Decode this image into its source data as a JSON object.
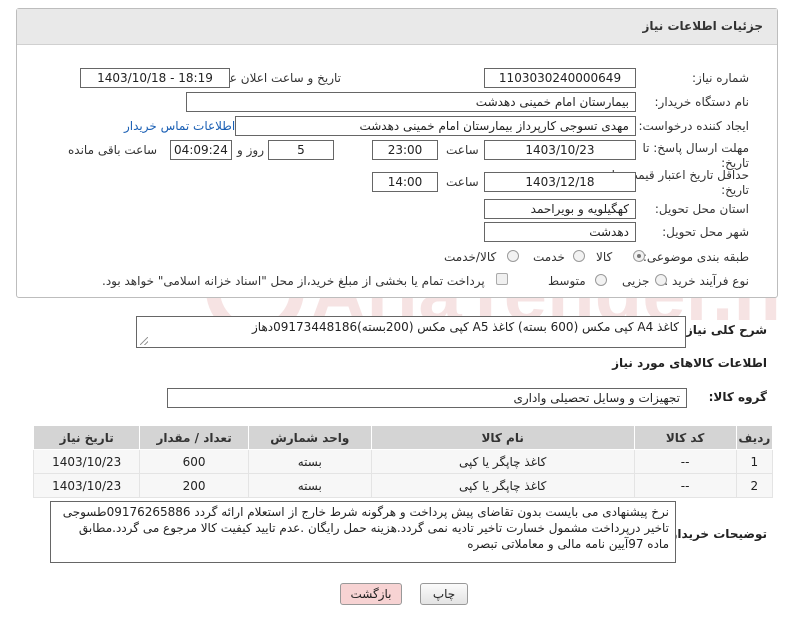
{
  "header": {
    "title": "جزئیات اطلاعات نیاز"
  },
  "fields": {
    "need_number": {
      "label": "شماره نیاز:",
      "value": "1103030240000649"
    },
    "announce_datetime": {
      "label": "تاریخ و ساعت اعلان عمومی:",
      "value": "1403/10/18 - 18:19"
    },
    "buyer_org": {
      "label": "نام دستگاه خریدار:",
      "value": "بیمارستان امام خمینی دهدشت"
    },
    "requester": {
      "label": "ایجاد کننده درخواست:",
      "value": "مهدی تسوجی کارپرداز بیمارستان امام خمینی دهدشت",
      "contact_link": "اطلاعات تماس خریدار"
    },
    "reply_deadline": {
      "label": "مهلت ارسال پاسخ: تا تاریخ:",
      "date": "1403/10/23",
      "time_label": "ساعت",
      "time": "23:00",
      "days": "5",
      "days_label": "روز و",
      "remaining": "04:09:24",
      "remaining_label": "ساعت باقی مانده"
    },
    "price_validity": {
      "label": "حداقل تاریخ اعتبار قیمت: تا تاریخ:",
      "date": "1403/12/18",
      "time_label": "ساعت",
      "time": "14:00"
    },
    "province": {
      "label": "استان محل تحویل:",
      "value": "کهگیلویه و بویراحمد"
    },
    "city": {
      "label": "شهر محل تحویل:",
      "value": "دهدشت"
    },
    "category": {
      "label": "طبقه بندی موضوعی:",
      "options": [
        "کالا",
        "خدمت",
        "کالا/خدمت"
      ],
      "selected": "کالا"
    },
    "purchase_type": {
      "label": "نوع فرآیند خرید :",
      "options": [
        "جزیی",
        "متوسط"
      ],
      "note": "پرداخت تمام یا بخشی از مبلغ خرید،از محل \"اسناد خزانه اسلامی\" خواهد بود."
    }
  },
  "summary": {
    "label": "شرح کلی نیاز:",
    "value": "کاغذ A4  کپی مکس (600 بسته) کاغذ A5 کپی مکس (200بسته)09173448186دهاز"
  },
  "goods": {
    "section_title": "اطلاعات کالاهای مورد نیاز",
    "group_label": "گروه کالا:",
    "group_value": "تجهیزات و وسایل تحصیلی واداری",
    "columns": [
      "ردیف",
      "کد کالا",
      "نام کالا",
      "واحد شمارش",
      "تعداد / مقدار",
      "تاریخ نیاز"
    ],
    "rows": [
      [
        "1",
        "--",
        "کاغذ چاپگر یا کپی",
        "بسته",
        "600",
        "1403/10/23"
      ],
      [
        "2",
        "--",
        "کاغذ چاپگر یا کپی",
        "بسته",
        "200",
        "1403/10/23"
      ]
    ]
  },
  "buyer_notes": {
    "label": "توضیحات خریدار:",
    "value": "نرخ پیشنهادی می بایست بدون تقاضای پیش پرداخت و هرگونه شرط خارج از استعلام ارائه گردد 09176265886طسوجی تاخیر درپرداخت مشمول خسارت تاخیر تادیه نمی گردد.هزینه حمل رایگان .عدم تایید کیفیت کالا مرجوع می گردد.مطابق ماده 97آیین نامه مالی و معاملاتی تبصره"
  },
  "buttons": {
    "print": "چاپ",
    "back": "بازگشت"
  },
  "colors": {
    "link": "#1a5fb4",
    "back_button_bg": "#f7d3d3",
    "table_header": "#d4d4d4"
  },
  "watermark": {
    "text": "AriaTender.neT"
  }
}
